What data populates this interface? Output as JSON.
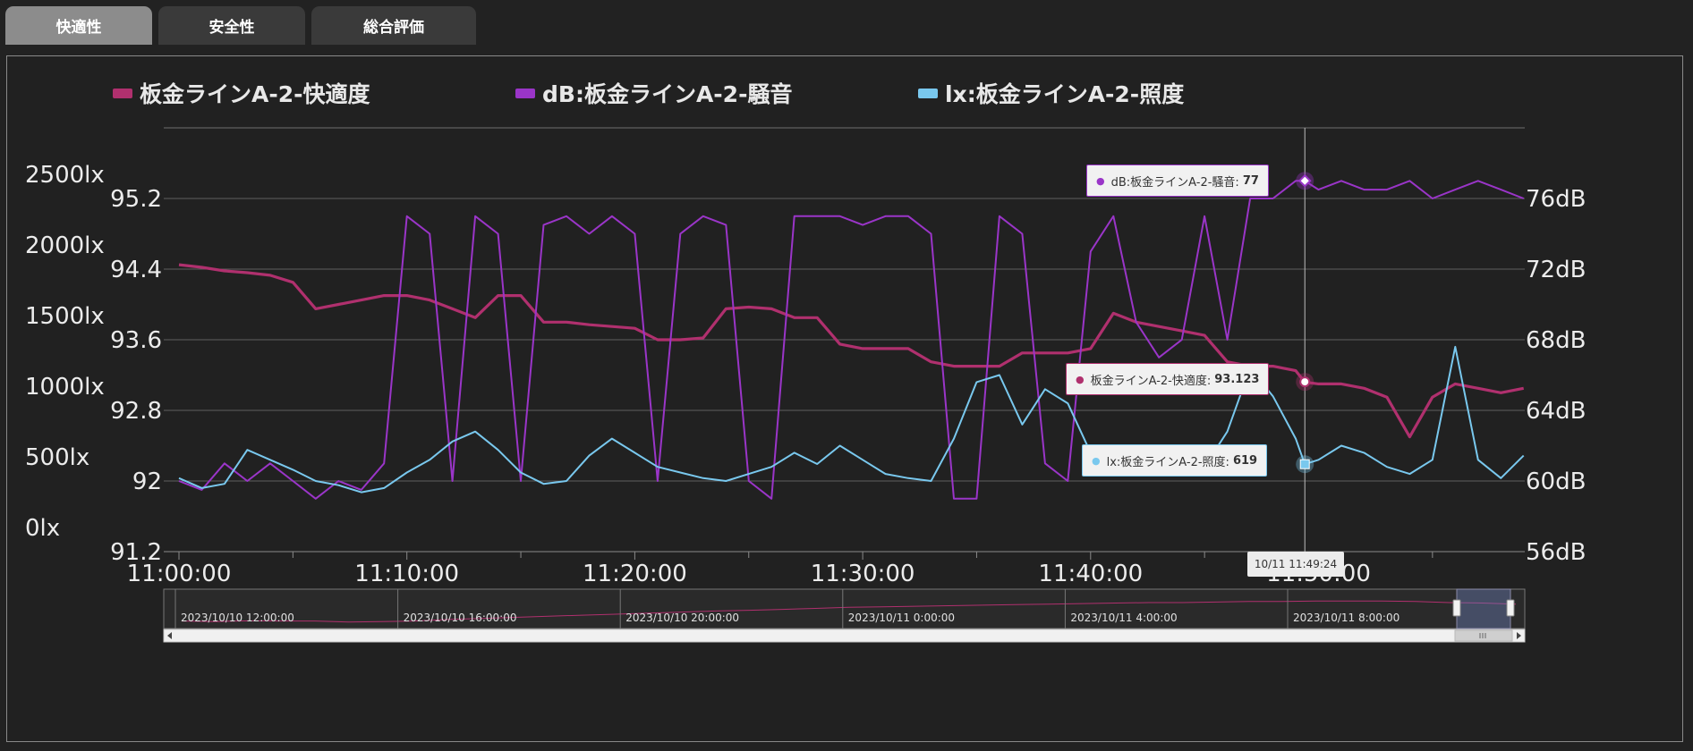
{
  "tabs": [
    {
      "label": "快適性",
      "active": true
    },
    {
      "label": "安全性",
      "active": false
    },
    {
      "label": "総合評価",
      "active": false
    }
  ],
  "colors": {
    "comfort": "#b0306e",
    "noise": "#9a35c8",
    "lux": "#79c8ee",
    "background": "#222222"
  },
  "chart_data": {
    "type": "line",
    "legend": [
      {
        "name": "板金ラインA-2-快適度",
        "color": "#b0306e"
      },
      {
        "name": "dB:板金ラインA-2-騒音",
        "color": "#9a35c8"
      },
      {
        "name": "lx:板金ラインA-2-照度",
        "color": "#79c8ee"
      }
    ],
    "x_ticks": [
      "11:00:00",
      "11:10:00",
      "11:20:00",
      "11:30:00",
      "11:40:00",
      "11:50:00"
    ],
    "xlim": [
      "11:00:00",
      "11:59:00"
    ],
    "y_left_comfort_ticks": [
      "91.2",
      "92",
      "92.8",
      "93.6",
      "94.4",
      "95.2"
    ],
    "y_left_comfort_range": [
      91.2,
      95.2
    ],
    "y_left_lux_ticks": [
      "0lx",
      "500lx",
      "1000lx",
      "1500lx",
      "2000lx",
      "2500lx"
    ],
    "y_left_lux_range": [
      0,
      2500
    ],
    "y_right_db_ticks": [
      "56dB",
      "60dB",
      "64dB",
      "68dB",
      "72dB",
      "76dB"
    ],
    "y_right_db_range": [
      56,
      76
    ],
    "grid": true,
    "legend_position": "top",
    "series": [
      {
        "name": "板金ラインA-2-快適度",
        "color": "#b0306e",
        "x": [
          "11:00:00",
          "11:01:00",
          "11:02:00",
          "11:03:00",
          "11:04:00",
          "11:05:00",
          "11:06:00",
          "11:07:00",
          "11:08:00",
          "11:09:00",
          "11:10:00",
          "11:11:00",
          "11:12:00",
          "11:13:00",
          "11:14:00",
          "11:15:00",
          "11:16:00",
          "11:17:00",
          "11:18:00",
          "11:19:00",
          "11:20:00",
          "11:21:00",
          "11:22:00",
          "11:23:00",
          "11:24:00",
          "11:25:00",
          "11:26:00",
          "11:27:00",
          "11:28:00",
          "11:29:00",
          "11:30:00",
          "11:31:00",
          "11:32:00",
          "11:33:00",
          "11:34:00",
          "11:35:00",
          "11:36:00",
          "11:37:00",
          "11:38:00",
          "11:39:00",
          "11:40:00",
          "11:41:00",
          "11:42:00",
          "11:43:00",
          "11:44:00",
          "11:45:00",
          "11:46:00",
          "11:47:00",
          "11:48:00",
          "11:49:00",
          "11:49:24",
          "11:50:00",
          "11:51:00",
          "11:52:00",
          "11:53:00",
          "11:54:00",
          "11:55:00",
          "11:56:00",
          "11:57:00",
          "11:58:00",
          "11:59:00"
        ],
        "values": [
          94.45,
          94.42,
          94.38,
          94.36,
          94.33,
          94.25,
          93.95,
          94.0,
          94.05,
          94.1,
          94.1,
          94.05,
          93.95,
          93.85,
          94.1,
          94.1,
          93.8,
          93.8,
          93.77,
          93.75,
          93.73,
          93.6,
          93.6,
          93.62,
          93.95,
          93.97,
          93.95,
          93.85,
          93.85,
          93.55,
          93.5,
          93.5,
          93.5,
          93.35,
          93.3,
          93.3,
          93.3,
          93.45,
          93.45,
          93.45,
          93.5,
          93.9,
          93.8,
          93.75,
          93.7,
          93.65,
          93.35,
          93.3,
          93.3,
          93.25,
          93.12,
          93.1,
          93.1,
          93.05,
          92.95,
          92.5,
          92.95,
          93.1,
          93.05,
          93.0,
          93.05
        ]
      },
      {
        "name": "dB:板金ラインA-2-騒音",
        "color": "#9a35c8",
        "x": [
          "11:00:00",
          "11:01:00",
          "11:02:00",
          "11:03:00",
          "11:04:00",
          "11:05:00",
          "11:06:00",
          "11:07:00",
          "11:08:00",
          "11:09:00",
          "11:10:00",
          "11:11:00",
          "11:12:00",
          "11:13:00",
          "11:14:00",
          "11:15:00",
          "11:16:00",
          "11:17:00",
          "11:18:00",
          "11:19:00",
          "11:20:00",
          "11:21:00",
          "11:22:00",
          "11:23:00",
          "11:24:00",
          "11:25:00",
          "11:26:00",
          "11:27:00",
          "11:28:00",
          "11:29:00",
          "11:30:00",
          "11:31:00",
          "11:32:00",
          "11:33:00",
          "11:34:00",
          "11:35:00",
          "11:36:00",
          "11:37:00",
          "11:38:00",
          "11:39:00",
          "11:40:00",
          "11:41:00",
          "11:42:00",
          "11:43:00",
          "11:44:00",
          "11:45:00",
          "11:46:00",
          "11:47:00",
          "11:48:00",
          "11:49:00",
          "11:49:24",
          "11:50:00",
          "11:51:00",
          "11:52:00",
          "11:53:00",
          "11:54:00",
          "11:55:00",
          "11:56:00",
          "11:57:00",
          "11:58:00",
          "11:59:00"
        ],
        "values": [
          60,
          59.5,
          61,
          60,
          61,
          60,
          59,
          60,
          59.5,
          61,
          75,
          74,
          60,
          75,
          74,
          60,
          74.5,
          75,
          74,
          75,
          74,
          60,
          74,
          75,
          74.5,
          60,
          59,
          75,
          75,
          75,
          74.5,
          75,
          75,
          74,
          59,
          59,
          75,
          74,
          61,
          60,
          73,
          75,
          69,
          67,
          68,
          75,
          68,
          76,
          76,
          77,
          77,
          76.5,
          77,
          76.5,
          76.5,
          77,
          76,
          76.5,
          77,
          76.5,
          76
        ]
      },
      {
        "name": "lx:板金ラインA-2-照度",
        "color": "#79c8ee",
        "x": [
          "11:00:00",
          "11:01:00",
          "11:02:00",
          "11:03:00",
          "11:04:00",
          "11:05:00",
          "11:06:00",
          "11:07:00",
          "11:08:00",
          "11:09:00",
          "11:10:00",
          "11:11:00",
          "11:12:00",
          "11:13:00",
          "11:14:00",
          "11:15:00",
          "11:16:00",
          "11:17:00",
          "11:18:00",
          "11:19:00",
          "11:20:00",
          "11:21:00",
          "11:22:00",
          "11:23:00",
          "11:24:00",
          "11:25:00",
          "11:26:00",
          "11:27:00",
          "11:28:00",
          "11:29:00",
          "11:30:00",
          "11:31:00",
          "11:32:00",
          "11:33:00",
          "11:34:00",
          "11:35:00",
          "11:36:00",
          "11:37:00",
          "11:38:00",
          "11:39:00",
          "11:40:00",
          "11:41:00",
          "11:42:00",
          "11:43:00",
          "11:44:00",
          "11:45:00",
          "11:46:00",
          "11:47:00",
          "11:48:00",
          "11:49:00",
          "11:49:24",
          "11:50:00",
          "11:51:00",
          "11:52:00",
          "11:53:00",
          "11:54:00",
          "11:55:00",
          "11:56:00",
          "11:57:00",
          "11:58:00",
          "11:59:00"
        ],
        "values": [
          520,
          450,
          480,
          720,
          650,
          580,
          500,
          470,
          420,
          450,
          560,
          650,
          780,
          850,
          720,
          560,
          480,
          500,
          680,
          800,
          700,
          600,
          560,
          520,
          500,
          550,
          600,
          700,
          620,
          750,
          650,
          550,
          520,
          500,
          800,
          1200,
          1250,
          900,
          1150,
          1050,
          700,
          600,
          550,
          700,
          550,
          600,
          850,
          1300,
          1100,
          800,
          619,
          650,
          750,
          700,
          600,
          550,
          650,
          1450,
          650,
          520,
          680
        ]
      }
    ],
    "tooltip_time": "10/11 11:49:24",
    "tooltips": [
      {
        "label": "dB:板金ラインA-2-騒音:",
        "value": "77",
        "color": "#9a35c8"
      },
      {
        "label": "板金ラインA-2-快適度:",
        "value": "93.123",
        "color": "#b0306e"
      },
      {
        "label": "lx:板金ラインA-2-照度:",
        "value": "619",
        "color": "#79c8ee"
      }
    ],
    "navigator": {
      "labels": [
        "2023/10/10 12:00:00",
        "2023/10/10 16:00:00",
        "2023/10/10 20:00:00",
        "2023/10/11 0:00:00",
        "2023/10/11 4:00:00",
        "2023/10/11 8:00:00"
      ],
      "series_values": [
        92.6,
        92.55,
        92.62,
        92.6,
        92.6,
        92.5,
        92.55,
        92.6,
        92.75,
        92.85,
        92.95,
        93.05,
        93.15,
        93.25,
        93.35,
        93.45,
        93.55,
        93.62,
        93.7,
        93.8,
        93.9,
        93.95,
        94.0,
        94.05,
        94.1,
        94.15,
        94.2,
        94.25,
        94.3,
        94.35,
        94.35,
        94.4,
        94.45,
        94.45,
        94.5,
        94.5,
        94.5,
        94.45,
        94.35,
        94.3,
        94.2
      ]
    }
  }
}
